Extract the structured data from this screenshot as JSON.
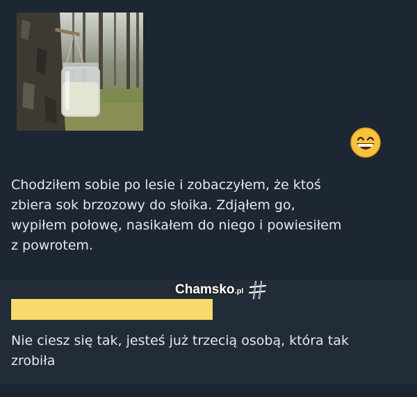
{
  "post": {
    "text": "Chodziłem sobie po lesie i zobaczyłem, że ktoś\nzbiera sok brzozowy do słoika. Zdjąłem go,\nwypiłem połowę, nasikałem do niego i powiesiłem\nz powrotem.",
    "photo_icon": "birch-tree-jar-photo",
    "reaction_icon": "grinning-face-emoji"
  },
  "watermark": {
    "logo_main": "Chamsko",
    "logo_suffix": ".pl",
    "logo_icon": "hashtag-icon"
  },
  "reply": {
    "text": "Nie ciesz się tak, jesteś już trzecią osobą, która tak\nzrobiła",
    "highlight_color": "#f7da6b"
  },
  "colors": {
    "background": "#1d2733",
    "text": "#e4e8ee"
  }
}
